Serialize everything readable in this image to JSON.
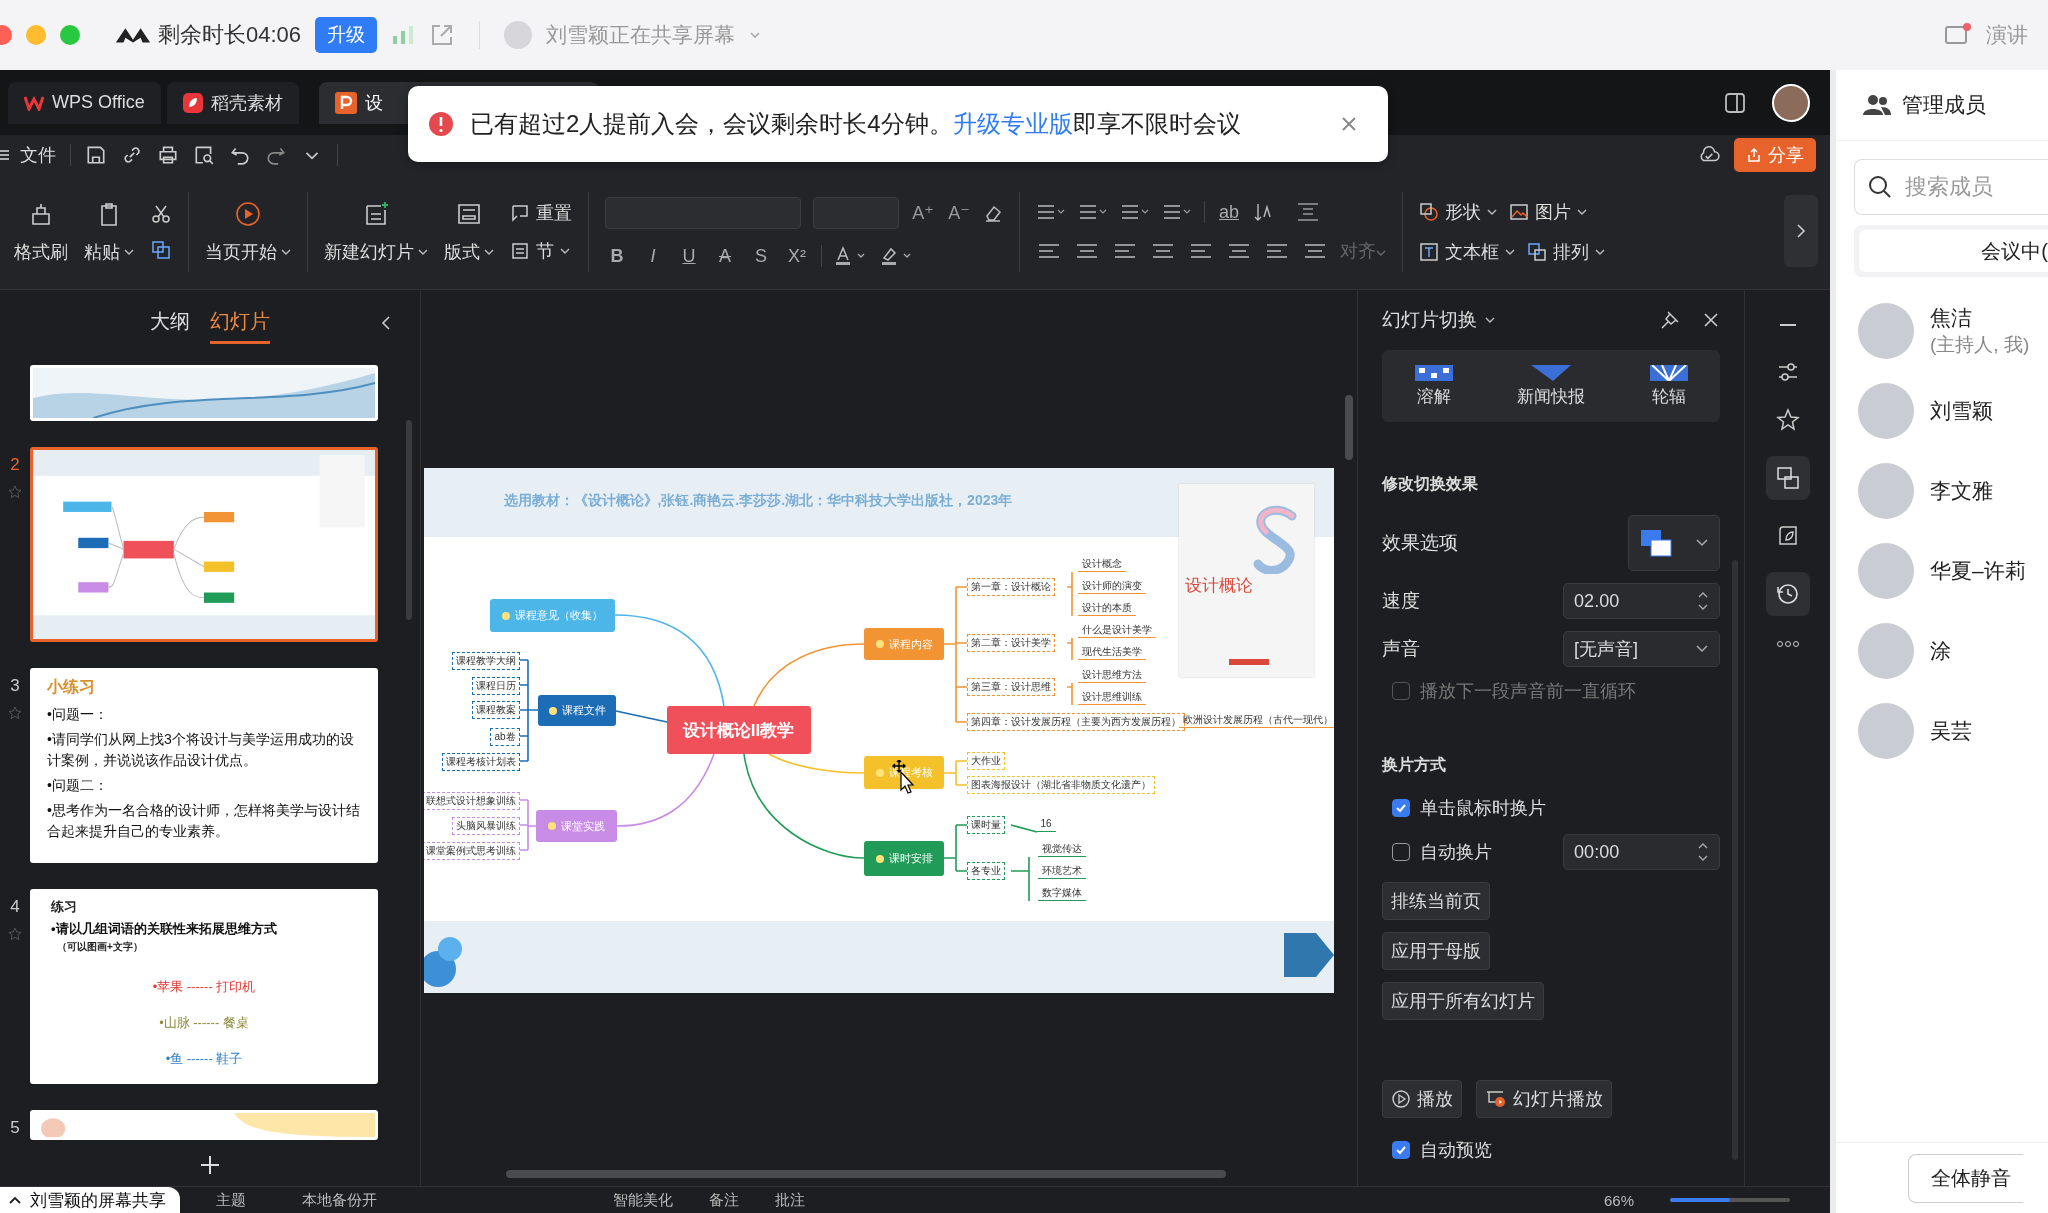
{
  "meeting_bar": {
    "remaining": "剩余时长04:06",
    "upgrade": "升级",
    "sharing": "刘雪颖正在共享屏幕",
    "presenter": "演讲"
  },
  "app_tabs": [
    {
      "label": "WPS Office",
      "kind": "wps",
      "selected": false
    },
    {
      "label": "稻壳素材",
      "kind": "docer",
      "selected": false
    },
    {
      "label": "设",
      "kind": "ppt",
      "selected": true
    }
  ],
  "notice": {
    "text": "已有超过2人提前入会，会议剩余时长4分钟。",
    "link": "升级专业版",
    "after": "即享不限时会议"
  },
  "menu": {
    "file": "文件",
    "share": "分享"
  },
  "ribbon": {
    "format_painter": "格式刷",
    "paste": "粘贴",
    "play_from_current": "当页开始",
    "new_slide": "新建幻灯片",
    "layout": "版式",
    "reset": "重置",
    "section": "节",
    "font_size_buttons": [
      "A⁺",
      "A⁻"
    ],
    "format_buttons": [
      "B",
      "I",
      "U",
      "A",
      "S",
      "X²"
    ],
    "text_effect": "ab",
    "align": {
      "label": "对齐",
      "disabled": true
    },
    "shape": "形状",
    "picture": "图片",
    "text_box": "文本框",
    "arrange": "排列"
  },
  "slides_panel": {
    "tabs": [
      {
        "label": "大纲",
        "selected": false
      },
      {
        "label": "幻灯片",
        "selected": true
      }
    ]
  },
  "slides": [
    {
      "kind": "wave",
      "selected": false
    },
    {
      "number": "2",
      "kind": "mindmap",
      "selected": true
    },
    {
      "number": "3",
      "kind": "exercise",
      "selected": false,
      "title": "小练习",
      "lines": [
        "•问题一：",
        "•请同学们从网上找3个将设计与美学运用成功的设计案例，并说说该作品设计优点。",
        "•问题二：",
        "•思考作为一名合格的设计师，怎样将美学与设计结合起来提升自己的专业素养。"
      ]
    },
    {
      "number": "4",
      "kind": "words",
      "selected": false,
      "title": "练习",
      "lines": [
        "•请以几组词语的关联性来拓展思维方式"
      ],
      "note": "（可以图画+文字）",
      "pairs": [
        {
          "text": "•苹果 ------ 打印机",
          "color": "#e53935"
        },
        {
          "text": "•山脉 ------ 餐桌",
          "color": "#8c8a3c"
        },
        {
          "text": "•鱼 ------ 鞋子",
          "color": "#2f7fc1"
        }
      ]
    },
    {
      "number": "5",
      "kind": "warm",
      "selected": false
    }
  ],
  "slide": {
    "header": "选用教材：《设计概论》,张钰.商艳云.李莎莎.湖北：华中科技大学出版社，2023年",
    "book_title": "设计概论",
    "center": "设计概论II教学",
    "branches": [
      {
        "label": "课程意见（收集）",
        "color": "#4db6e8"
      },
      {
        "label": "课程文件",
        "color": "#1c6db5",
        "items": [
          {
            "label": "课程教学大纲"
          },
          {
            "label": "课程日历"
          },
          {
            "label": "课程教案"
          },
          {
            "label": "ab卷"
          },
          {
            "label": "课程考核计划表"
          }
        ]
      },
      {
        "label": "课堂实践",
        "color": "#c98ce6",
        "items": [
          {
            "label": "联想式设计想象训练"
          },
          {
            "label": "头脑风暴训练"
          },
          {
            "label": "课堂案例式思考训练"
          }
        ]
      },
      {
        "label": "课程内容",
        "color": "#f29433",
        "items": [
          {
            "label": "第一章：设计概论",
            "children": [
              "设计概念",
              "设计师的演变",
              "设计的本质"
            ]
          },
          {
            "label": "第二章：设计美学",
            "children": [
              "什么是设计美学",
              "现代生活美学"
            ]
          },
          {
            "label": "第三章：设计思维",
            "children": [
              "设计思维方法",
              "设计思维训练"
            ]
          },
          {
            "label": "第四章：设计发展历程（主要为西方发展历程）",
            "children": [
              "欧洲设计发展历程（古代一现代）"
            ]
          }
        ]
      },
      {
        "label": "课程考核",
        "color": "#f4c12a",
        "items": [
          {
            "label": "大作业"
          },
          {
            "label": "图表海报设计（湖北省非物质文化遗产）"
          }
        ]
      },
      {
        "label": "课时安排",
        "color": "#219c58",
        "items": [
          {
            "label": "课时量",
            "children": [
              "16"
            ]
          },
          {
            "label": "各专业",
            "children": [
              "视觉传达",
              "环境艺术",
              "数字媒体"
            ]
          }
        ]
      }
    ]
  },
  "transition": {
    "title": "幻灯片切换",
    "effects": [
      {
        "label": "溶解",
        "kind": "dissolve"
      },
      {
        "label": "新闻快报",
        "kind": "newsflash"
      },
      {
        "label": "轮辐",
        "kind": "wheel"
      }
    ],
    "modify_heading": "修改切换效果",
    "effect_options": "效果选项",
    "speed": {
      "label": "速度",
      "value": "02.00"
    },
    "sound": {
      "label": "声音",
      "value": "[无声音]"
    },
    "loop": {
      "label": "播放下一段声音前一直循环",
      "checked": false,
      "disabled": true
    },
    "advance_heading": "换片方式",
    "on_click": {
      "label": "单击鼠标时换片",
      "checked": true
    },
    "auto_advance": {
      "label": "自动换片",
      "checked": false,
      "value": "00:00"
    },
    "buttons": [
      "排练当前页",
      "应用于母版",
      "应用于所有幻灯片"
    ],
    "play": "播放",
    "slideshow": "幻灯片播放",
    "auto_preview": {
      "label": "自动预览",
      "checked": true
    }
  },
  "members": {
    "title": "管理成员",
    "search_placeholder": "搜索成员",
    "tab": "会议中(",
    "list": [
      {
        "name": "焦洁",
        "role": "(主持人, 我)"
      },
      {
        "name": "刘雪颖"
      },
      {
        "name": "李文雅"
      },
      {
        "name": "华夏–许莉"
      },
      {
        "name": "涂"
      },
      {
        "name": "吴芸"
      }
    ],
    "mute_all": "全体静音"
  },
  "status_bar": {
    "share_label": "刘雪颖的屏幕共享",
    "items": [
      "主题",
      "本地备份开",
      "智能美化",
      "备注",
      "批注"
    ],
    "zoom": "66%",
    "zoom_slider": {
      "level": 0.5
    }
  }
}
